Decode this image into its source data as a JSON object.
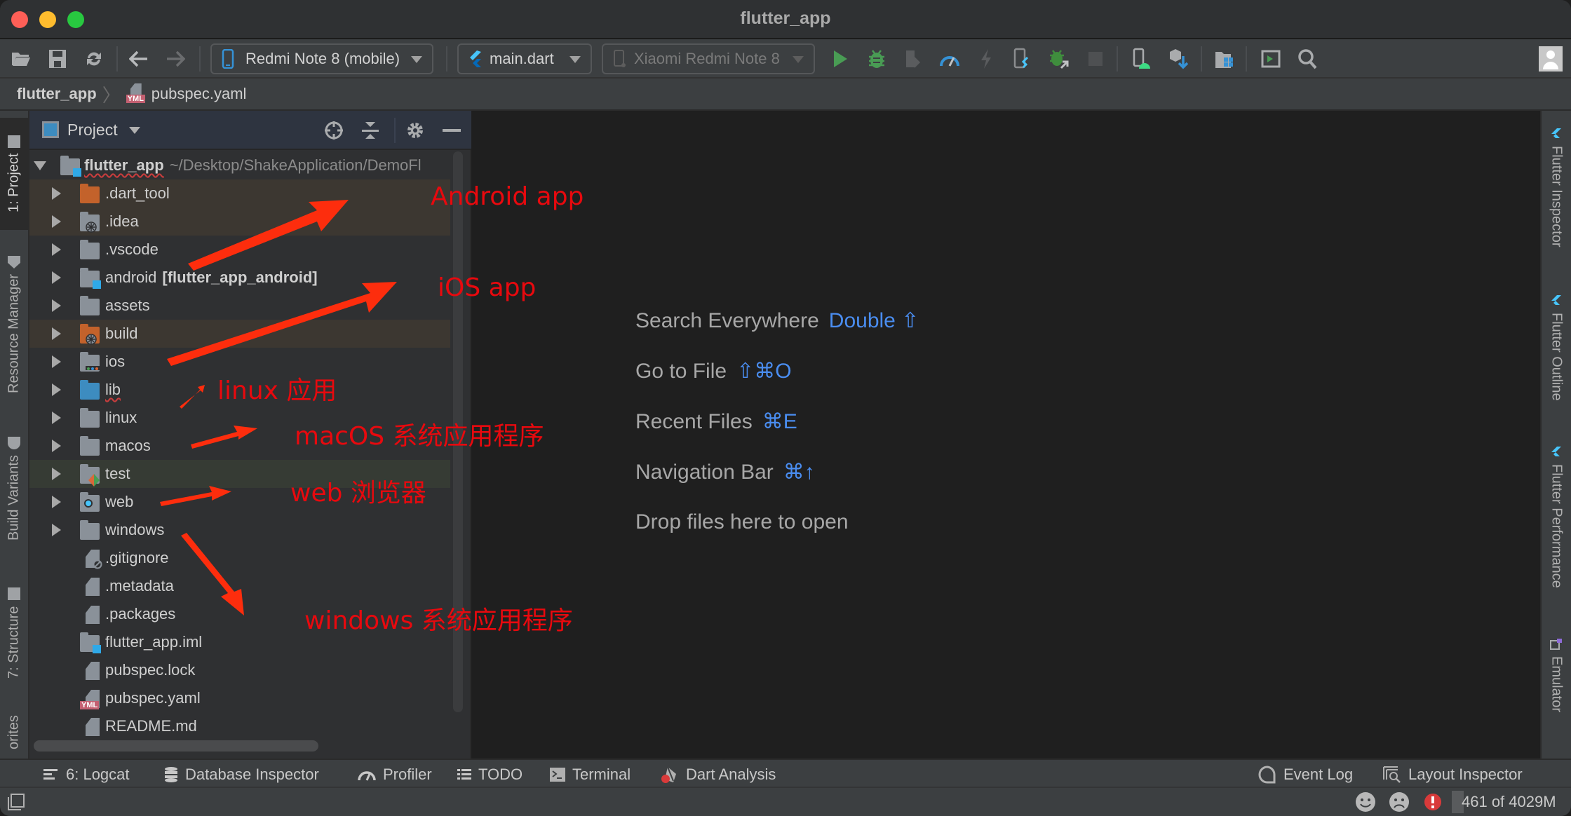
{
  "window": {
    "title": "flutter_app"
  },
  "toolbar": {
    "device_selector": "Redmi Note 8 (mobile)",
    "run_config": "main.dart",
    "device_disabled": "Xiaomi Redmi Note 8",
    "icons": [
      "open-folder",
      "save-all",
      "sync",
      "back",
      "forward",
      "run",
      "debug",
      "attach-debugger",
      "profile",
      "apply-changes",
      "flutter-hot-reload",
      "debug-attach",
      "stop",
      "avd-manager",
      "sdk-manager",
      "project-structure",
      "run-anything",
      "search",
      "user-avatar"
    ]
  },
  "breadcrumb": {
    "root": "flutter_app",
    "separator": "〉",
    "file": "pubspec.yaml",
    "file_badge": "YML"
  },
  "left_strip": {
    "tabs": [
      {
        "label": "1: Project",
        "active": true
      },
      {
        "label": "Resource Manager",
        "active": false
      },
      {
        "label": "Build Variants",
        "active": false
      },
      {
        "label": "7: Structure",
        "active": false
      },
      {
        "label": "orites",
        "active": false
      }
    ]
  },
  "right_strip": {
    "tabs": [
      {
        "label": "Flutter Inspector"
      },
      {
        "label": "Flutter Outline"
      },
      {
        "label": "Flutter Performance"
      },
      {
        "label": "Emulator"
      }
    ]
  },
  "project_panel": {
    "title": "Project",
    "root": {
      "name": "flutter_app",
      "path": "~/Desktop/ShakeApplication/DemoFl"
    },
    "items": [
      {
        "name": ".dart_tool",
        "type": "folder",
        "color": "orange",
        "highlight": "brown"
      },
      {
        "name": ".idea",
        "type": "folder-gear",
        "highlight": "brown"
      },
      {
        "name": ".vscode",
        "type": "folder"
      },
      {
        "name": "android",
        "suffix": "[flutter_app_android]",
        "type": "folder-module"
      },
      {
        "name": "assets",
        "type": "folder"
      },
      {
        "name": "build",
        "type": "folder-gear-orange",
        "highlight": "brown"
      },
      {
        "name": "ios",
        "type": "folder-ios"
      },
      {
        "name": "lib",
        "type": "folder",
        "color": "blue"
      },
      {
        "name": "linux",
        "type": "folder"
      },
      {
        "name": "macos",
        "type": "folder"
      },
      {
        "name": "test",
        "type": "folder-test",
        "highlight": "green"
      },
      {
        "name": "web",
        "type": "folder-web"
      },
      {
        "name": "windows",
        "type": "folder"
      },
      {
        "name": ".gitignore",
        "type": "file-ignore"
      },
      {
        "name": ".metadata",
        "type": "file"
      },
      {
        "name": ".packages",
        "type": "file"
      },
      {
        "name": "flutter_app.iml",
        "type": "file-module"
      },
      {
        "name": "pubspec.lock",
        "type": "file"
      },
      {
        "name": "pubspec.yaml",
        "type": "file-yaml",
        "badge": "YML"
      },
      {
        "name": "README.md",
        "type": "file"
      }
    ]
  },
  "editor": {
    "hints": [
      {
        "label": "Search Everywhere",
        "shortcut": "Double ⇧"
      },
      {
        "label": "Go to File",
        "shortcut": "⇧⌘O"
      },
      {
        "label": "Recent Files",
        "shortcut": "⌘E"
      },
      {
        "label": "Navigation Bar",
        "shortcut": "⌘↑"
      },
      {
        "label": "Drop files here to open",
        "shortcut": ""
      }
    ]
  },
  "annotations": [
    {
      "text": "Android app"
    },
    {
      "text": "iOS app"
    },
    {
      "text": "linux 应用"
    },
    {
      "text": "macOS 系统应用程序"
    },
    {
      "text": "web 浏览器"
    },
    {
      "text": "windows  系统应用程序"
    }
  ],
  "annotation_color": "#e8090e",
  "bottom_tabs": {
    "left": [
      {
        "label": "6: Logcat"
      },
      {
        "label": "Database Inspector"
      },
      {
        "label": "Profiler"
      },
      {
        "label": "TODO"
      },
      {
        "label": "Terminal"
      },
      {
        "label": "Dart Analysis"
      }
    ],
    "right": [
      {
        "label": "Event Log"
      },
      {
        "label": "Layout Inspector"
      }
    ]
  },
  "status_bar": {
    "memory": "461 of 4029M",
    "memory_used_fraction": 0.114
  },
  "colors": {
    "accent_blue": "#4a8df0",
    "run_green": "#499c54",
    "error_red": "#d93a3a"
  }
}
